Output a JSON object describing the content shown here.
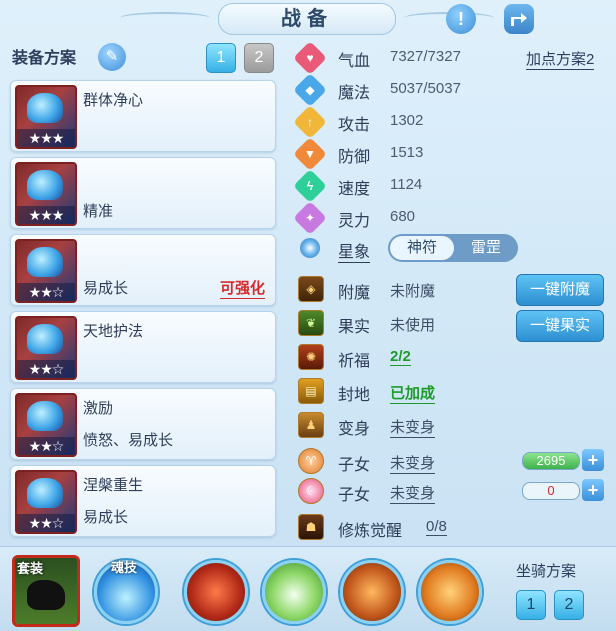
{
  "header": {
    "title": "战备"
  },
  "left": {
    "heading": "装备方案",
    "pages": [
      "1",
      "2"
    ],
    "cards": [
      {
        "name": "群体净心",
        "sub": "",
        "tag": "",
        "stars": "★★★",
        "color": "#3fa6e8"
      },
      {
        "name": "",
        "sub": "精准",
        "tag": "",
        "stars": "★★★",
        "color": "#36c2d8"
      },
      {
        "name": "",
        "sub": "易成长",
        "tag": "可强化",
        "stars": "★★☆",
        "color": "#2f8de6"
      },
      {
        "name": "天地护法",
        "sub": "",
        "tag": "",
        "stars": "★★☆",
        "color": "#3aa0e0"
      },
      {
        "name": "激励",
        "sub": "愤怒、易成长",
        "tag": "",
        "stars": "★★☆",
        "color": "#3b8ee8"
      },
      {
        "name": "涅槃重生",
        "sub": "易成长",
        "tag": "",
        "stars": "★★☆",
        "color": "#3ba7ea"
      }
    ]
  },
  "stats": {
    "plan_link": "加点方案2",
    "items": [
      {
        "label": "气血",
        "value": "7327/7327",
        "color": "#e85a78",
        "glyph": "♥"
      },
      {
        "label": "魔法",
        "value": "5037/5037",
        "color": "#4aa8e8",
        "glyph": "◆"
      },
      {
        "label": "攻击",
        "value": "1302",
        "color": "#f0b73a",
        "glyph": "↑"
      },
      {
        "label": "防御",
        "value": "1513",
        "color": "#f08a3a",
        "glyph": "▼"
      },
      {
        "label": "速度",
        "value": "1124",
        "color": "#2fcf9a",
        "glyph": "ϟ"
      },
      {
        "label": "灵力",
        "value": "680",
        "color": "#c97ae0",
        "glyph": "✦"
      }
    ],
    "star": {
      "label": "星象",
      "opt_a": "神符",
      "opt_b": "雷罡"
    }
  },
  "extras": [
    {
      "label": "附魔",
      "value": "未附魔",
      "style": "",
      "btn": "一键附魔"
    },
    {
      "label": "果实",
      "value": "未使用",
      "style": "",
      "btn": "一键果实"
    },
    {
      "label": "祈福",
      "value": "2/2",
      "style": "green",
      "btn": ""
    },
    {
      "label": "封地",
      "value": "已加成",
      "style": "green",
      "btn": ""
    },
    {
      "label": "变身",
      "value": "未变身",
      "style": "ul",
      "btn": ""
    },
    {
      "label": "子女",
      "value": "未变身",
      "style": "ul",
      "bar": "2695"
    },
    {
      "label": "子女",
      "value": "未变身",
      "style": "ul",
      "bar": "0"
    },
    {
      "label": "修炼觉醒",
      "value": "0/8",
      "style": "ul",
      "btn": ""
    }
  ],
  "bottom": {
    "suit_label": "套装",
    "skill_label": "魂技",
    "mount_title": "坐骑方案",
    "mount_pages": [
      "1",
      "2"
    ]
  }
}
